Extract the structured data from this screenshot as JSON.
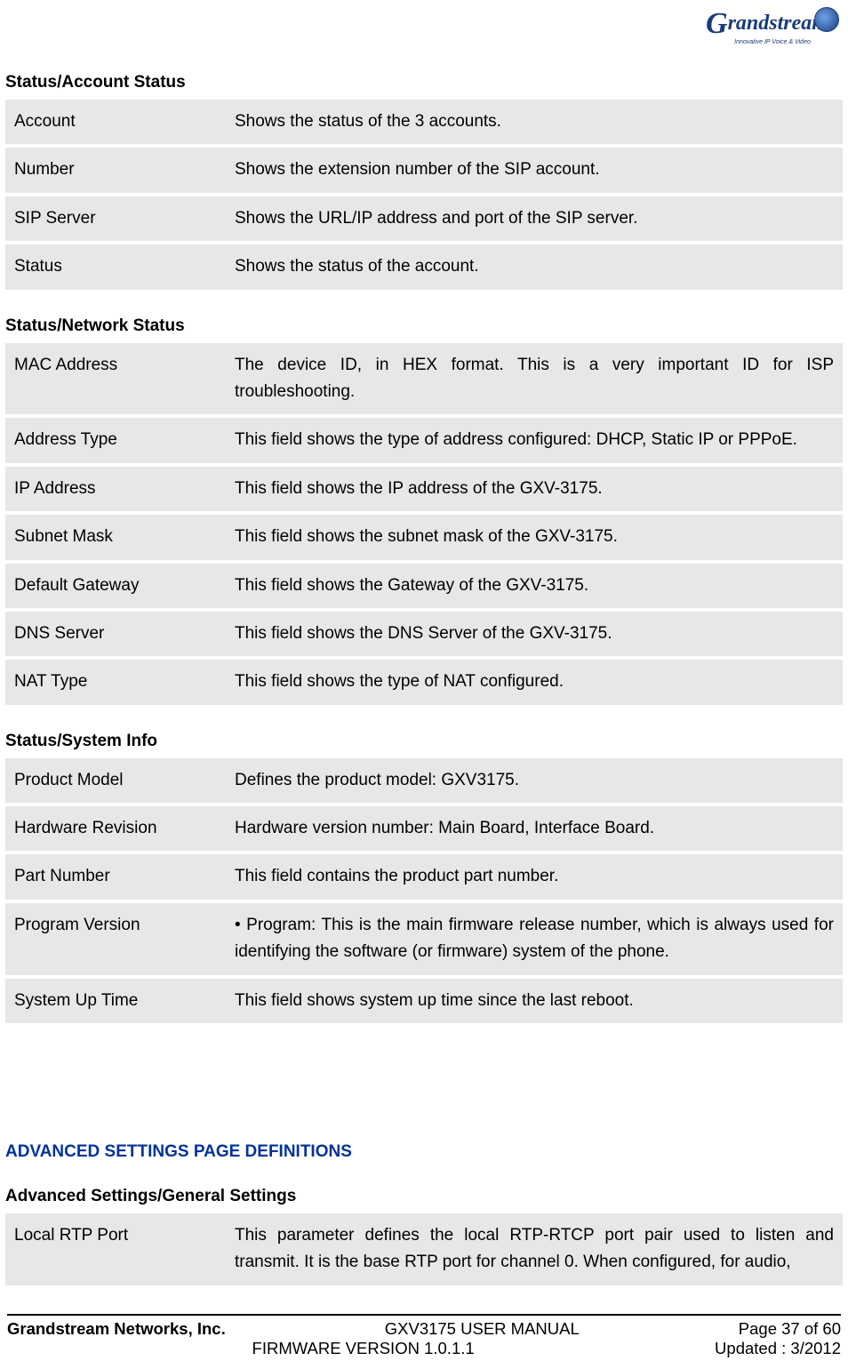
{
  "logo": {
    "brand_g": "G",
    "brand_rest": "randstream",
    "tag": "Innovative IP Voice & Video"
  },
  "sections": {
    "account_status": {
      "title": "Status/Account Status",
      "rows": [
        {
          "key": "Account",
          "val": "Shows the status of the 3 accounts."
        },
        {
          "key": "Number",
          "val": "Shows the extension number of the SIP account."
        },
        {
          "key": "SIP Server",
          "val": "Shows the URL/IP address and port of the SIP server."
        },
        {
          "key": "Status",
          "val": "Shows the status of the account."
        }
      ]
    },
    "network_status": {
      "title": "Status/Network Status",
      "rows": [
        {
          "key": "MAC Address",
          "val": "The device ID, in HEX format. This is a very important ID for ISP troubleshooting."
        },
        {
          "key": "Address Type",
          "val": "This field shows the type of address configured: DHCP, Static IP or PPPoE."
        },
        {
          "key": "IP Address",
          "val": "This field shows the IP address of the GXV-3175."
        },
        {
          "key": "Subnet Mask",
          "val": "This field shows the subnet mask of the GXV-3175."
        },
        {
          "key": "Default Gateway",
          "val": "This field shows the Gateway of the GXV-3175."
        },
        {
          "key": "DNS Server",
          "val": "This field shows the DNS Server of the GXV-3175."
        },
        {
          "key": "NAT Type",
          "val": "This field shows the type of NAT configured."
        }
      ]
    },
    "system_info": {
      "title": "Status/System Info",
      "rows": [
        {
          "key": "Product Model",
          "val": "Defines the product model: GXV3175."
        },
        {
          "key": "Hardware Revision",
          "val": "Hardware version number: Main Board, Interface Board."
        },
        {
          "key": "Part Number",
          "val": "This field contains the product part number."
        },
        {
          "key": "Program Version",
          "val": "• Program: This is the main firmware release number, which is always used for identifying the software (or firmware) system of the phone."
        },
        {
          "key": "System Up Time",
          "val": "This field shows system up time since the last reboot."
        }
      ]
    },
    "advanced_heading": "ADVANCED SETTINGS PAGE DEFINITIONS",
    "general_settings": {
      "title": "Advanced Settings/General Settings",
      "rows": [
        {
          "key": "Local RTP Port",
          "val": "This parameter defines the local RTP-RTCP port pair used to listen and transmit. It is the base RTP port for channel 0. When configured, for audio,"
        }
      ]
    }
  },
  "footer": {
    "company": "Grandstream Networks, Inc.",
    "manual": "GXV3175 USER MANUAL",
    "firmware": "FIRMWARE VERSION 1.0.1.1",
    "page": "Page 37 of 60",
    "updated": "Updated : 3/2012"
  }
}
